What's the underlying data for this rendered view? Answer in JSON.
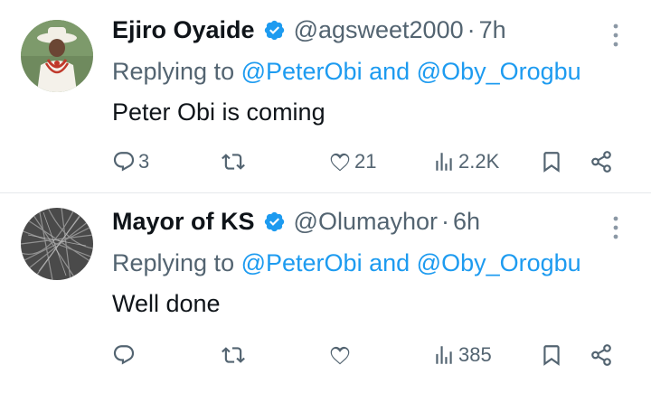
{
  "tweets": [
    {
      "name": "Ejiro Oyaide",
      "handle": "@agsweet2000",
      "time": "7h",
      "replying_prefix": "Replying to",
      "mention1": "@PeterObi",
      "and_word": "and",
      "mention2": "@Oby_Orogbu",
      "text": "Peter Obi is coming",
      "replies": "3",
      "retweets": "",
      "likes": "21",
      "views": "2.2K"
    },
    {
      "name": "Mayor of KS",
      "handle": "@Olumayhor",
      "time": "6h",
      "replying_prefix": "Replying to",
      "mention1": "@PeterObi",
      "and_word": "and",
      "mention2": "@Oby_Orogbu",
      "text": "Well done",
      "replies": "",
      "retweets": "",
      "likes": "",
      "views": "385"
    }
  ],
  "icons": {
    "verified": "verified-badge-icon",
    "more": "more-vertical-icon",
    "reply": "reply-icon",
    "retweet": "retweet-icon",
    "like": "heart-icon",
    "views": "views-icon",
    "bookmark": "bookmark-icon",
    "share": "share-icon"
  },
  "colors": {
    "accent": "#1d9bf0",
    "muted": "#536471",
    "text": "#0f1419"
  }
}
